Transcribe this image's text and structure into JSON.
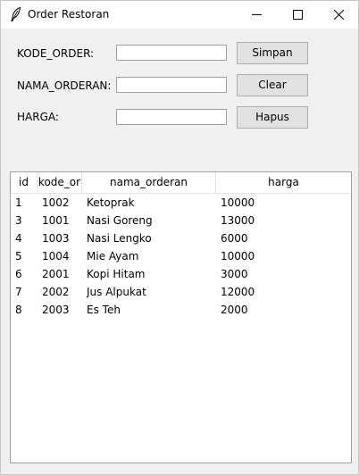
{
  "window": {
    "title": "Order Restoran",
    "icon": "feather-icon"
  },
  "form": {
    "kode_label": "KODE_ORDER:",
    "nama_label": "NAMA_ORDERAN:",
    "harga_label": "HARGA:",
    "kode_value": "",
    "nama_value": "",
    "harga_value": ""
  },
  "buttons": {
    "simpan": "Simpan",
    "clear": "Clear",
    "hapus": "Hapus"
  },
  "table": {
    "headers": [
      "id",
      "kode_or",
      "nama_orderan",
      "harga"
    ],
    "rows": [
      [
        "1",
        "1002",
        "Ketoprak",
        "10000"
      ],
      [
        "3",
        "1001",
        "Nasi Goreng",
        "13000"
      ],
      [
        "4",
        "1003",
        "Nasi Lengko",
        "6000"
      ],
      [
        "5",
        "1004",
        "Mie Ayam",
        "10000"
      ],
      [
        "6",
        "2001",
        "Kopi Hitam",
        "3000"
      ],
      [
        "7",
        "2002",
        "Jus Alpukat",
        "12000"
      ],
      [
        "8",
        "2003",
        "Es Teh",
        "2000"
      ]
    ]
  }
}
